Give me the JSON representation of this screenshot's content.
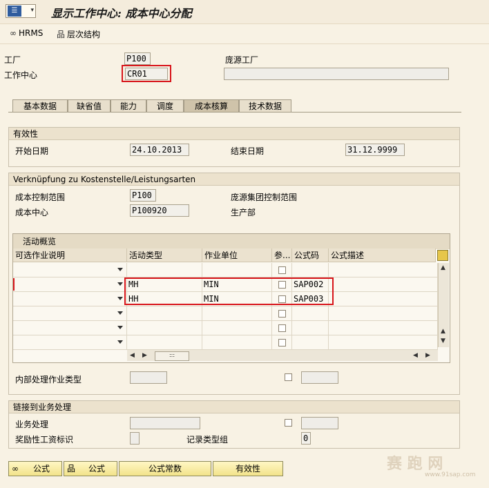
{
  "window": {
    "title": "显示工作中心: 成本中心分配"
  },
  "toolbar": {
    "hrms_label": "HRMS",
    "hierarchy_label": "层次结构"
  },
  "header": {
    "plant_label": "工厂",
    "plant_value": "P100",
    "workcenter_label": "工作中心",
    "workcenter_value": "CR01",
    "plant_name_label": "庞源工厂"
  },
  "tabs": [
    {
      "label": "基本数据"
    },
    {
      "label": "缺省值"
    },
    {
      "label": "能力"
    },
    {
      "label": "调度"
    },
    {
      "label": "成本核算",
      "active": true
    },
    {
      "label": "技术数据"
    }
  ],
  "validity": {
    "section_title": "有效性",
    "start_label": "开始日期",
    "start_value": "24.10.2013",
    "end_label": "结束日期",
    "end_value": "31.12.9999"
  },
  "link": {
    "section_title": "Verknüpfung zu Kostenstelle/Leistungsarten",
    "ctrl_area_label": "成本控制范围",
    "ctrl_area_value": "P100",
    "ctrl_area_desc": "庞源集团控制范围",
    "cost_center_label": "成本中心",
    "cost_center_value": "P100920",
    "cost_center_desc": "生产部"
  },
  "activity_table": {
    "title": "活动概览",
    "columns": [
      "可选作业说明",
      "活动类型",
      "作业单位",
      "参...",
      "公式码",
      "公式描述"
    ],
    "rows": [
      {
        "desc": "",
        "type": "",
        "unit": "",
        "code": ""
      },
      {
        "desc": "",
        "type": "MH",
        "unit": "MIN",
        "code": "SAP002"
      },
      {
        "desc": "",
        "type": "HH",
        "unit": "MIN",
        "code": "SAP003"
      },
      {
        "desc": "",
        "type": "",
        "unit": "",
        "code": ""
      },
      {
        "desc": "",
        "type": "",
        "unit": "",
        "code": ""
      },
      {
        "desc": "",
        "type": "",
        "unit": "",
        "code": ""
      }
    ],
    "hscroll_label": ":::"
  },
  "internal": {
    "label": "内部处理作业类型"
  },
  "business": {
    "section_title": "链接到业务处理",
    "process_label": "业务处理",
    "incentive_label": "奖励性工资标识",
    "record_type_label": "记录类型组",
    "record_type_value": "0"
  },
  "buttons": {
    "formula1": "公式",
    "formula2": "公式",
    "formula_const": "公式常数",
    "validity": "有效性"
  },
  "watermark": {
    "text": "赛 跑 网",
    "url": "www.91sap.com"
  },
  "colors": {
    "highlight_red": "#d8141a",
    "button_yellow": "#f2e38a",
    "background": "#f8f2e4"
  }
}
